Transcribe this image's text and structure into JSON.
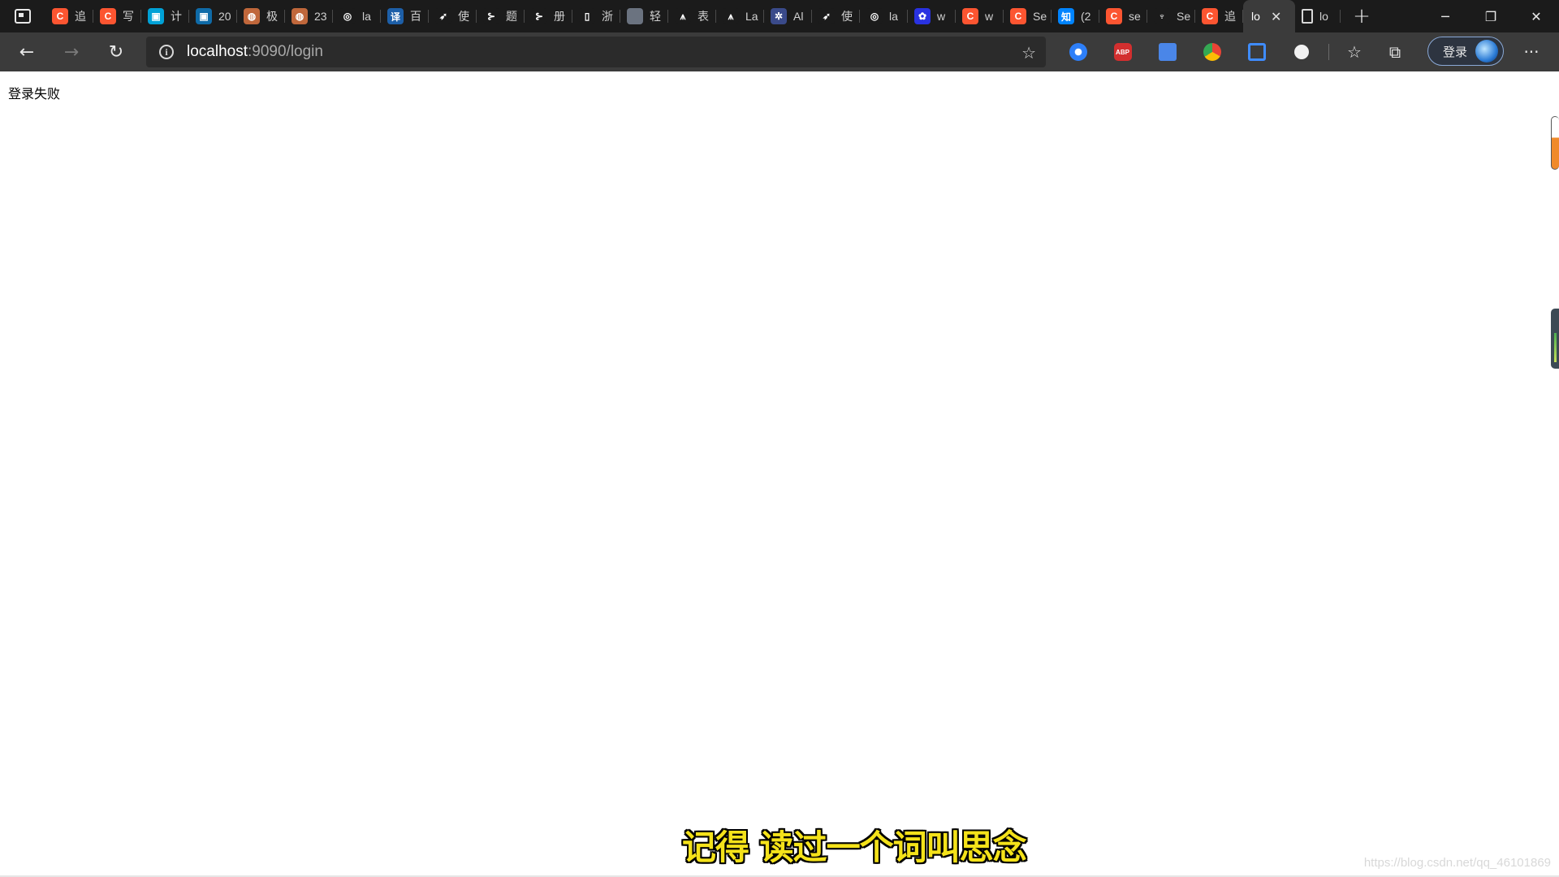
{
  "browser": {
    "tabs": [
      {
        "title": "追",
        "color": "#fc5531",
        "glyph": "C"
      },
      {
        "title": "写",
        "color": "#fc5531",
        "glyph": "C"
      },
      {
        "title": "计",
        "color": "#00a1d6",
        "glyph": "▣"
      },
      {
        "title": "20",
        "color": "#0f6ba8",
        "glyph": "▣"
      },
      {
        "title": "极",
        "color": "#c0673b",
        "glyph": "◍"
      },
      {
        "title": "23",
        "color": "#c0673b",
        "glyph": "◍"
      },
      {
        "title": "la",
        "color": "#1b1b1b",
        "glyph": "◎"
      },
      {
        "title": "百",
        "color": "#1d5fa8",
        "glyph": "译"
      },
      {
        "title": "使",
        "color": "#1b1b1b",
        "glyph": "➶"
      },
      {
        "title": "题",
        "color": "#1b1b1b",
        "glyph": "⊱"
      },
      {
        "title": "册",
        "color": "#1b1b1b",
        "glyph": "⊱"
      },
      {
        "title": "浙",
        "color": "#1b1b1b",
        "glyph": "▯"
      },
      {
        "title": "轻",
        "color": "#6b7380",
        "glyph": " "
      },
      {
        "title": "表",
        "color": "#1b1b1b",
        "glyph": "⩚"
      },
      {
        "title": "La",
        "color": "#1b1b1b",
        "glyph": "⩚"
      },
      {
        "title": "Al",
        "color": "#3a4a8a",
        "glyph": "✲"
      },
      {
        "title": "使",
        "color": "#1b1b1b",
        "glyph": "➶"
      },
      {
        "title": "la",
        "color": "#1b1b1b",
        "glyph": "◎"
      },
      {
        "title": "w",
        "color": "#2932e1",
        "glyph": "✿"
      },
      {
        "title": "w",
        "color": "#fc5531",
        "glyph": "C"
      },
      {
        "title": "Se",
        "color": "#fc5531",
        "glyph": "C"
      },
      {
        "title": "(2",
        "color": "#0084ff",
        "glyph": "知"
      },
      {
        "title": "se",
        "color": "#fc5531",
        "glyph": "C"
      },
      {
        "title": "Se",
        "color": "#1b1b1b",
        "glyph": "♆"
      },
      {
        "title": "追",
        "color": "#fc5531",
        "glyph": "C"
      }
    ],
    "active_tab": {
      "title": "lo",
      "close": "✕"
    },
    "last_tab": {
      "title": "lo"
    },
    "new_tab": "+",
    "window": {
      "minimize": "─",
      "restore": "❐",
      "close": "✕"
    },
    "nav": {
      "back": "←",
      "forward": "→",
      "reload": "↻"
    },
    "address": {
      "host": "localhost",
      "rest": ":9090/login",
      "info": "i",
      "fav_add": "☆"
    },
    "profile_label": "登录",
    "more": "···"
  },
  "page": {
    "message": "登录失败",
    "subtitle": "记得 读过一个词叫思念",
    "watermark": "https://blog.csdn.net/qq_46101869"
  }
}
